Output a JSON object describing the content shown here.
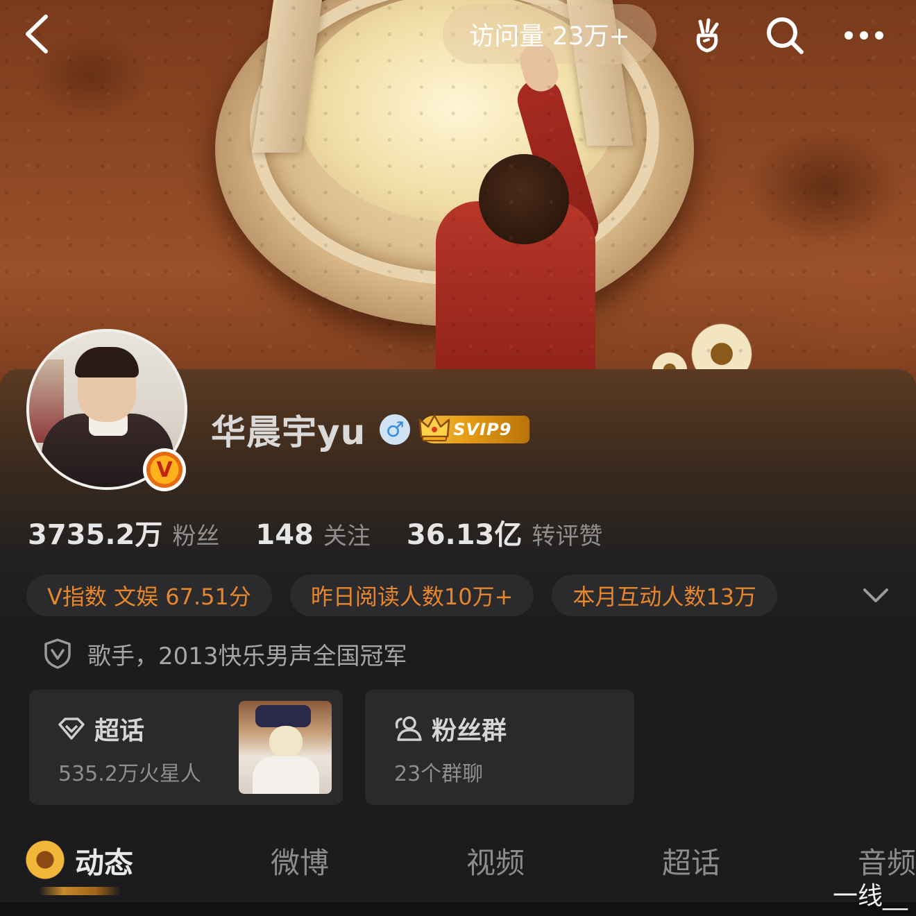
{
  "topbar": {
    "visits_label": "访问量 23万+",
    "icons": [
      "back-arrow-icon",
      "carrot-icon",
      "search-icon",
      "more-icon"
    ]
  },
  "profile": {
    "name": "华晨宇yu",
    "gender_symbol": "♂",
    "vip_badge": "SVIP9",
    "verified_badge": "V"
  },
  "stats": [
    {
      "value": "3735.2万",
      "label": "粉丝"
    },
    {
      "value": "148",
      "label": "关注"
    },
    {
      "value": "36.13亿",
      "label": "转评赞"
    }
  ],
  "chips": [
    "V指数  文娱  67.51分",
    "昨日阅读人数10万+",
    "本月互动人数13万"
  ],
  "verification": "歌手，2013快乐男声全国冠军",
  "tiles": {
    "supertopic": {
      "title": "超话",
      "subtitle": "535.2万火星人"
    },
    "fangroup": {
      "title": "粉丝群",
      "subtitle": "23个群聊"
    }
  },
  "tabs": [
    "动态",
    "微博",
    "视频",
    "超话",
    "音频"
  ],
  "watermark": "一线__",
  "colors": {
    "accent_orange": "#e6872e",
    "card_bg": "#1c1c1e",
    "chip_bg": "#2b2a2c",
    "gender_blue": "#3b8de0"
  }
}
